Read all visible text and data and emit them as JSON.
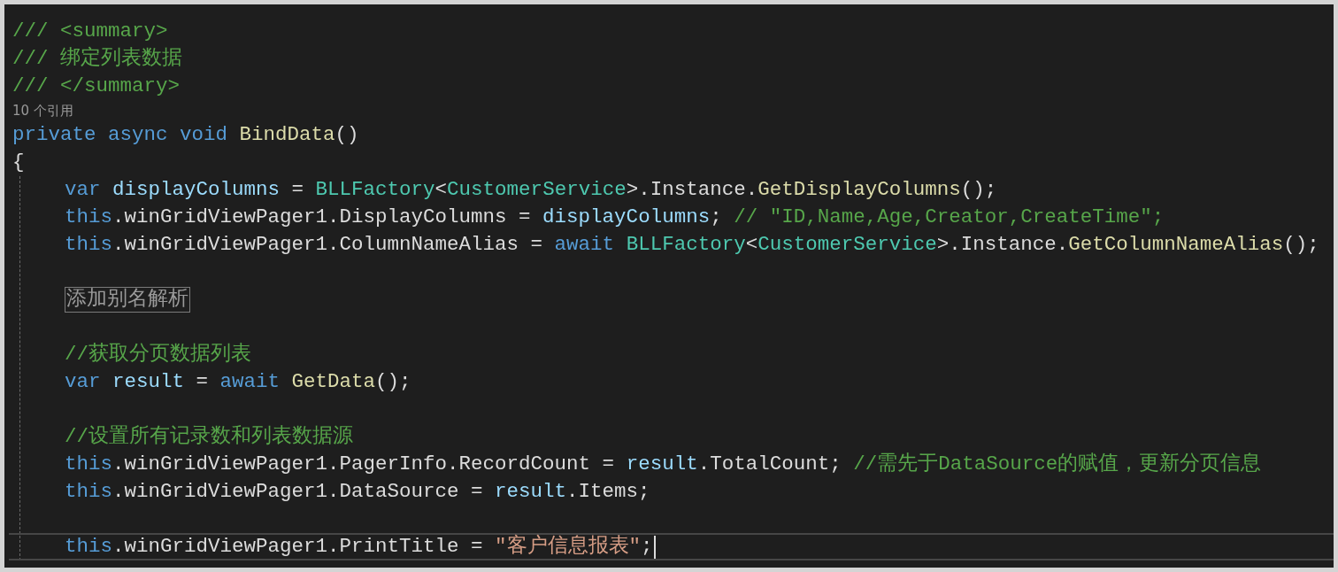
{
  "editor": {
    "lines": [
      {
        "kind": "code",
        "tokens": [
          {
            "kind": "comment",
            "t": "/// <summary>"
          }
        ]
      },
      {
        "kind": "code",
        "tokens": [
          {
            "kind": "comment",
            "t": "/// 绑定列表数据"
          }
        ]
      },
      {
        "kind": "code",
        "tokens": [
          {
            "kind": "comment",
            "t": "/// </summary>"
          }
        ]
      },
      {
        "kind": "codelens",
        "text": "10 个引用"
      },
      {
        "kind": "code",
        "tokens": [
          {
            "kind": "keyword",
            "t": "private async void "
          },
          {
            "kind": "method",
            "t": "BindData"
          },
          {
            "kind": "plain",
            "t": "()"
          }
        ]
      },
      {
        "kind": "block",
        "open": "{",
        "children": [
          {
            "kind": "code",
            "tokens": [
              {
                "kind": "keyword",
                "t": "var "
              },
              {
                "kind": "variable",
                "t": "displayColumns"
              },
              {
                "kind": "plain",
                "t": " = "
              },
              {
                "kind": "type",
                "t": "BLLFactory"
              },
              {
                "kind": "plain",
                "t": "<"
              },
              {
                "kind": "type",
                "t": "CustomerService"
              },
              {
                "kind": "plain",
                "t": ">.Instance."
              },
              {
                "kind": "method",
                "t": "GetDisplayColumns"
              },
              {
                "kind": "plain",
                "t": "();"
              }
            ]
          },
          {
            "kind": "code",
            "tokens": [
              {
                "kind": "keyword",
                "t": "this"
              },
              {
                "kind": "plain",
                "t": ".winGridViewPager1.DisplayColumns = "
              },
              {
                "kind": "variable",
                "t": "displayColumns"
              },
              {
                "kind": "plain",
                "t": "; "
              },
              {
                "kind": "comment",
                "t": "// \"ID,Name,Age,Creator,CreateTime\";"
              }
            ]
          },
          {
            "kind": "code",
            "tokens": [
              {
                "kind": "keyword",
                "t": "this"
              },
              {
                "kind": "plain",
                "t": ".winGridViewPager1.ColumnNameAlias = "
              },
              {
                "kind": "keyword",
                "t": "await "
              },
              {
                "kind": "type",
                "t": "BLLFactory"
              },
              {
                "kind": "plain",
                "t": "<"
              },
              {
                "kind": "type",
                "t": "CustomerService"
              },
              {
                "kind": "plain",
                "t": ">.Instance."
              },
              {
                "kind": "method",
                "t": "GetColumnNameAlias"
              },
              {
                "kind": "plain",
                "t": "();"
              }
            ]
          },
          {
            "kind": "blank"
          },
          {
            "kind": "collapsed",
            "text": "添加别名解析"
          },
          {
            "kind": "blank"
          },
          {
            "kind": "code",
            "tokens": [
              {
                "kind": "comment",
                "t": "//获取分页数据列表"
              }
            ]
          },
          {
            "kind": "code",
            "tokens": [
              {
                "kind": "keyword",
                "t": "var "
              },
              {
                "kind": "variable",
                "t": "result"
              },
              {
                "kind": "plain",
                "t": " = "
              },
              {
                "kind": "keyword",
                "t": "await "
              },
              {
                "kind": "method",
                "t": "GetData"
              },
              {
                "kind": "plain",
                "t": "();"
              }
            ]
          },
          {
            "kind": "blank"
          },
          {
            "kind": "code",
            "tokens": [
              {
                "kind": "comment",
                "t": "//设置所有记录数和列表数据源"
              }
            ]
          },
          {
            "kind": "code",
            "tokens": [
              {
                "kind": "keyword",
                "t": "this"
              },
              {
                "kind": "plain",
                "t": ".winGridViewPager1.PagerInfo.RecordCount = "
              },
              {
                "kind": "variable",
                "t": "result"
              },
              {
                "kind": "plain",
                "t": ".TotalCount; "
              },
              {
                "kind": "comment",
                "t": "//需先于DataSource的赋值，更新分页信息"
              }
            ]
          },
          {
            "kind": "code",
            "tokens": [
              {
                "kind": "keyword",
                "t": "this"
              },
              {
                "kind": "plain",
                "t": ".winGridViewPager1.DataSource = "
              },
              {
                "kind": "variable",
                "t": "result"
              },
              {
                "kind": "plain",
                "t": ".Items;"
              }
            ]
          },
          {
            "kind": "blank"
          },
          {
            "kind": "code",
            "current": true,
            "tokens": [
              {
                "kind": "keyword",
                "t": "this"
              },
              {
                "kind": "plain",
                "t": ".winGridViewPager1.PrintTitle = "
              },
              {
                "kind": "string",
                "t": "\"客户信息报表\""
              },
              {
                "kind": "plain",
                "t": ";"
              }
            ]
          }
        ]
      }
    ]
  }
}
